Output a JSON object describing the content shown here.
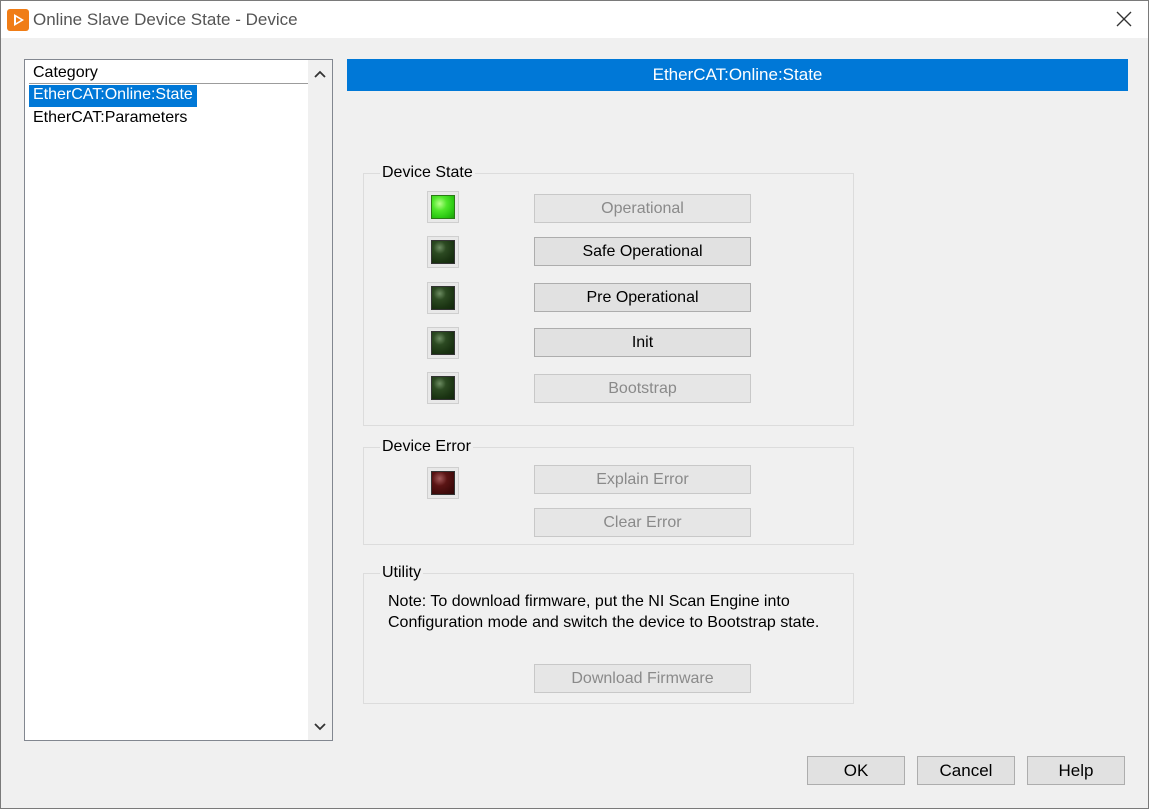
{
  "window": {
    "title": "Online Slave Device State - Device",
    "app_icon": "labview-play-icon",
    "close_icon": "close-icon"
  },
  "category": {
    "header": "Category",
    "items": [
      {
        "label": "EtherCAT:Online:State",
        "selected": true
      },
      {
        "label": "EtherCAT:Parameters",
        "selected": false
      }
    ],
    "scroll_up_icon": "chevron-up-icon",
    "scroll_down_icon": "chevron-down-icon"
  },
  "panel_title": "EtherCAT:Online:State",
  "device_state": {
    "label": "Device State",
    "states": [
      {
        "button": "Operational",
        "led": "on",
        "enabled": false
      },
      {
        "button": "Safe Operational",
        "led": "off",
        "enabled": true
      },
      {
        "button": "Pre Operational",
        "led": "off",
        "enabled": true
      },
      {
        "button": "Init",
        "led": "off",
        "enabled": true
      },
      {
        "button": "Bootstrap",
        "led": "off",
        "enabled": false
      }
    ]
  },
  "device_error": {
    "label": "Device Error",
    "led": "err",
    "explain_button": "Explain Error",
    "clear_button": "Clear Error"
  },
  "utility": {
    "label": "Utility",
    "note": "Note: To download firmware, put the NI Scan Engine into Configuration mode and switch the device to Bootstrap state.",
    "download_button": "Download Firmware"
  },
  "dialog_buttons": {
    "ok": "OK",
    "cancel": "Cancel",
    "help": "Help"
  },
  "colors": {
    "accent": "#0078d7",
    "led_on": "#3fd61e",
    "led_off": "#1f3a16",
    "led_error": "#4a0e0e"
  }
}
